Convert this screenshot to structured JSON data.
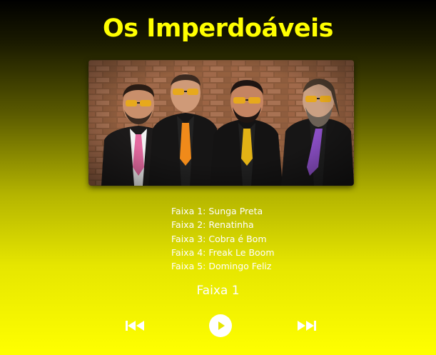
{
  "band": {
    "name": "Os Imperdoáveis"
  },
  "photo": {
    "alt": "Foto da banda Os Imperdoáveis"
  },
  "tracks": [
    {
      "label": "Faixa 1: Sunga Preta"
    },
    {
      "label": "Faixa 2: Renatinha"
    },
    {
      "label": "Faixa 3: Cobra é Bom"
    },
    {
      "label": "Faixa 4: Freak Le Boom"
    },
    {
      "label": "Faixa 5: Domingo Feliz"
    }
  ],
  "player": {
    "current_track": "Faixa 1"
  },
  "controls": {
    "prev_icon": "skip-previous-icon",
    "play_icon": "play-icon",
    "next_icon": "skip-next-icon"
  },
  "colors": {
    "accent": "#ffff00",
    "text": "#ffffff",
    "background_top": "#000000",
    "background_bottom": "#ffff00"
  }
}
